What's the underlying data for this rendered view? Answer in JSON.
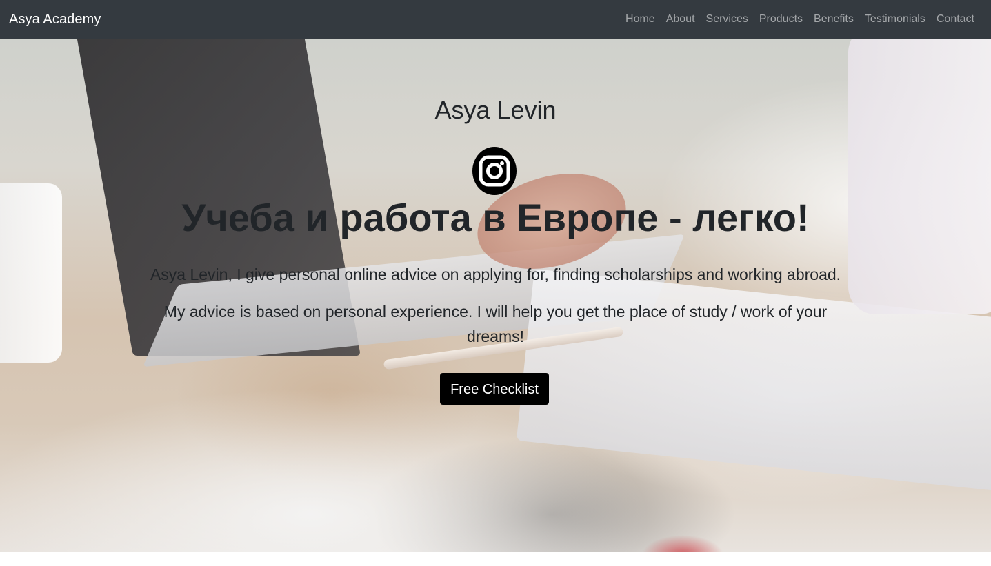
{
  "navbar": {
    "brand": "Asya Academy",
    "links": [
      "Home",
      "About",
      "Services",
      "Products",
      "Benefits",
      "Testimonials",
      "Contact"
    ]
  },
  "hero": {
    "name": "Asya Levin",
    "instagram_icon": "instagram-icon",
    "headline": "Учеба и работа в Европе - легко!",
    "lead_1": "Asya Levin, I give personal online advice on applying for, finding scholarships and working abroad.",
    "lead_2": "My advice is based on personal experience. I will help you get the place of study / work of your dreams!",
    "cta_label": "Free Checklist"
  },
  "colors": {
    "navbar_bg": "#343a40",
    "brand_text": "#ffffff",
    "nav_link": "rgba(255,255,255,0.55)",
    "hero_text": "#212529",
    "button_bg": "#000000"
  }
}
